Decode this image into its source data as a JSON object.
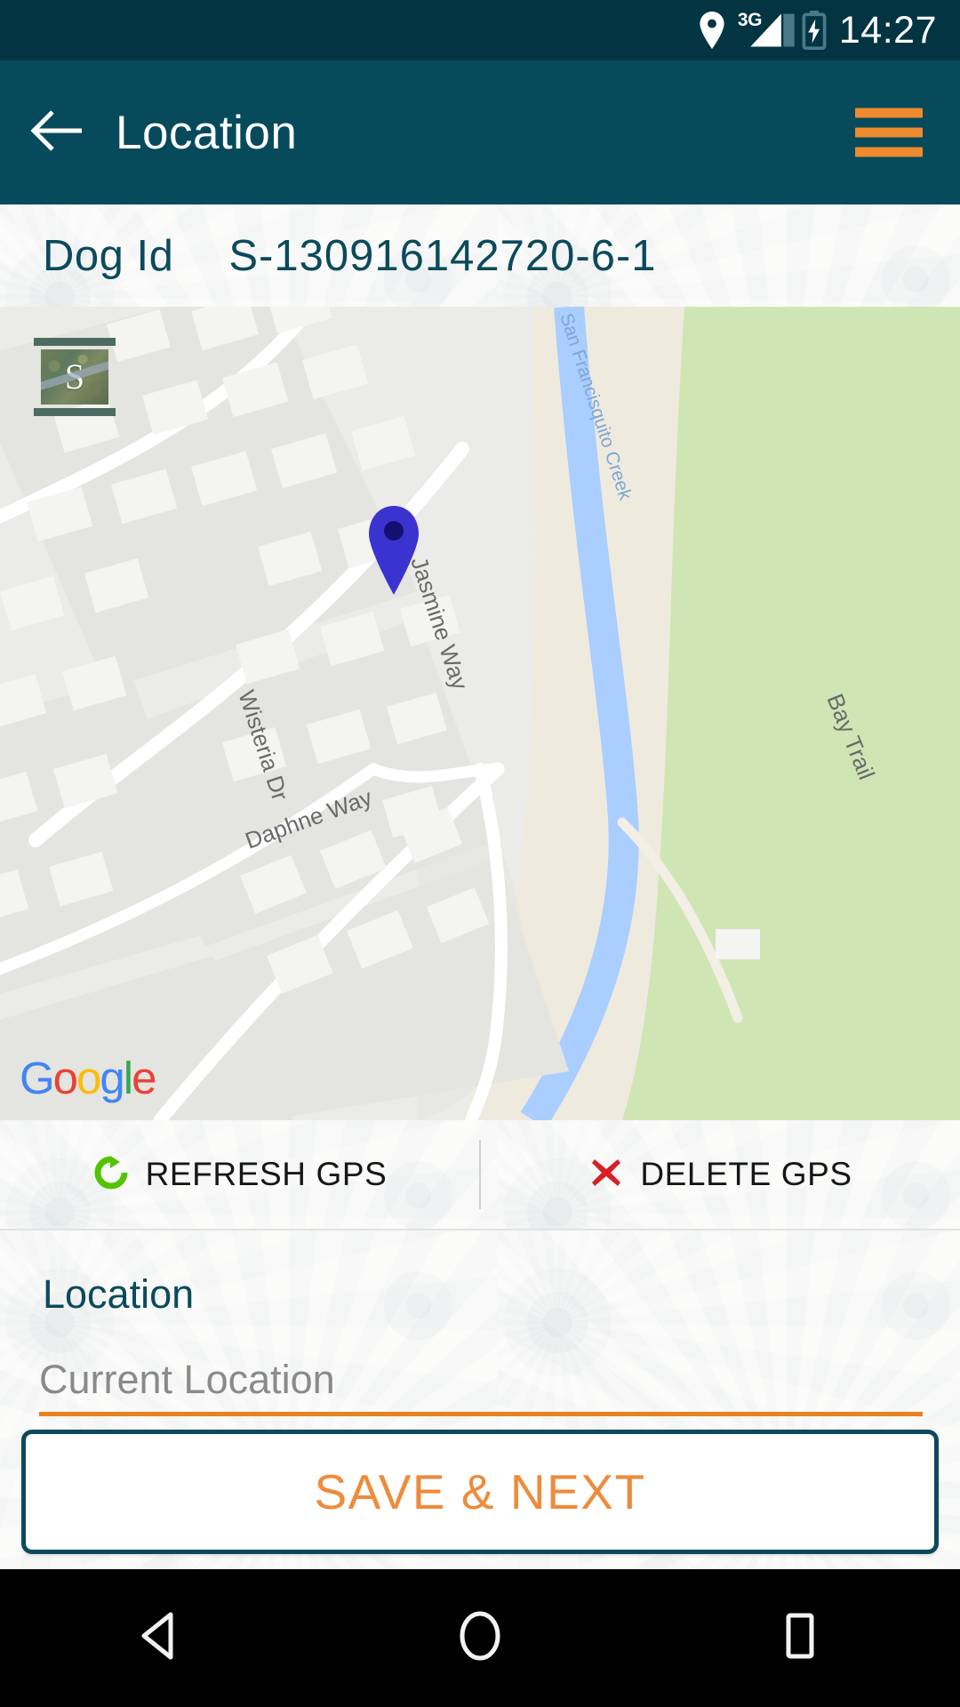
{
  "status_bar": {
    "time": "14:27",
    "icons": [
      "location-pin-icon",
      "3g-signal-icon",
      "battery-charging-icon"
    ],
    "network_label": "3G",
    "background_color": "#023442"
  },
  "app_bar": {
    "title": "Location",
    "back_icon": "arrow-left-icon",
    "menu_icon": "hamburger-menu-icon",
    "background_color": "#064A5C",
    "menu_color": "#EE8B2E"
  },
  "dog_id": {
    "label": "Dog Id",
    "value": "S-130916142720-6-1",
    "text_color": "#0B4A5C"
  },
  "map": {
    "provider_logo": "Google",
    "provider_letters": [
      "G",
      "o",
      "o",
      "g",
      "l",
      "e"
    ],
    "layer_toggle_label": "S",
    "layer_toggle_name": "satellite-layer-toggle",
    "marker": {
      "name": "location-marker-pin",
      "color": "#3b33d0"
    },
    "street_labels": [
      "San Francisquito Creek",
      "Jasmine Way",
      "Wisteria Dr",
      "Daphne Way",
      "Bay Trail"
    ],
    "water_color": "#a9ceff",
    "park_color": "#cfe6b4",
    "land_color": "#ebebe9",
    "road_color": "#ffffff"
  },
  "gps_actions": {
    "refresh": {
      "label": "REFRESH GPS",
      "icon": "refresh-icon",
      "icon_color": "#53C400"
    },
    "delete": {
      "label": "DELETE GPS",
      "icon": "close-x-icon",
      "icon_color": "#D81F26"
    }
  },
  "location_form": {
    "section_title": "Location",
    "input_value": "",
    "input_placeholder": "Current Location",
    "underline_color": "#E8821E"
  },
  "save_button": {
    "label": "SAVE & NEXT",
    "text_color": "#EE8B3C",
    "border_color": "#0B4A5C"
  },
  "navigation_bar": {
    "back_label": "back-triangle-icon",
    "home_label": "home-circle-icon",
    "recents_label": "recents-square-icon"
  }
}
